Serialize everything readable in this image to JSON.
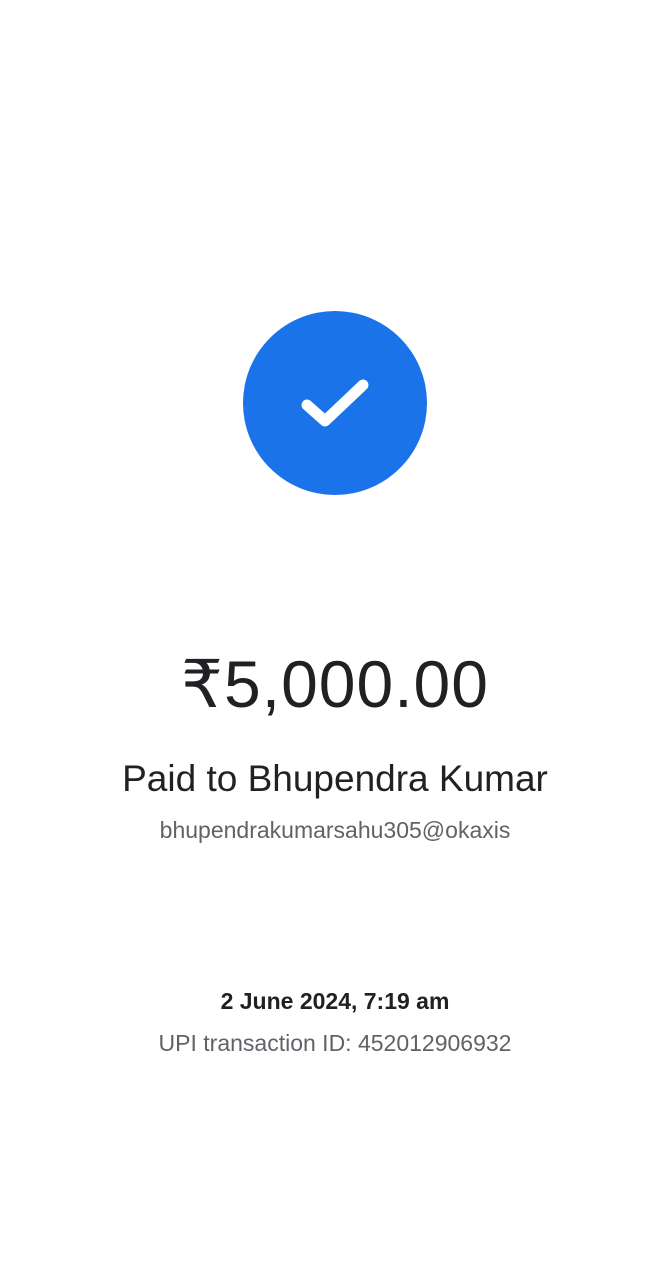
{
  "status": {
    "icon": "checkmark-icon",
    "accent_color": "#1a73e8"
  },
  "payment": {
    "amount": "₹5,000.00",
    "paid_to": "Paid to Bhupendra Kumar",
    "upi_id": "bhupendrakumarsahu305@okaxis"
  },
  "transaction": {
    "datetime": "2 June 2024, 7:19 am",
    "upi_transaction_id": "UPI transaction ID: 452012906932"
  }
}
